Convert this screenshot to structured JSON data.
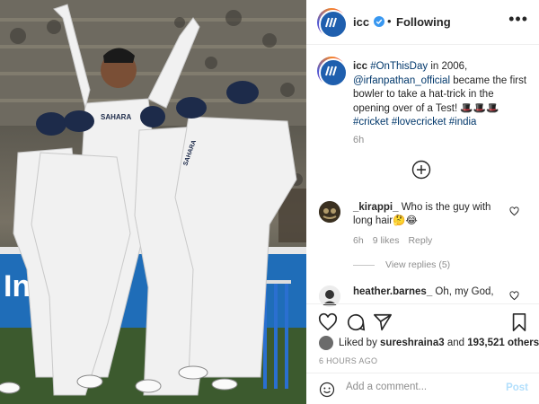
{
  "photo": {
    "description_icon": "cricket-celebration-photo",
    "shirt_text_1": "SAHARA",
    "shirt_text_2": "SAHARA",
    "banner_text": "Ina"
  },
  "header": {
    "username": "icc",
    "separator": "•",
    "follow_status": "Following",
    "more_icon": "more-horizontal-icon",
    "verified_icon": "verified-badge-icon"
  },
  "caption": {
    "username": "icc",
    "segments": [
      {
        "text": "#OnThisDay",
        "link": true
      },
      {
        "text": " in 2006, ",
        "link": false
      },
      {
        "text": "@irfanpathan_official",
        "link": true
      },
      {
        "text": " became the first bowler to take a hat-trick in the opening over of a Test! 🎩🎩🎩 ",
        "link": false
      },
      {
        "text": "#cricket",
        "link": true
      },
      {
        "text": " ",
        "link": false
      },
      {
        "text": "#lovecricket",
        "link": true
      },
      {
        "text": " ",
        "link": false
      },
      {
        "text": "#india",
        "link": true
      }
    ],
    "time": "6h"
  },
  "comments": [
    {
      "username": "_kirappi_",
      "text": "Who is the guy with long hair🤔😂",
      "time": "6h",
      "likes": "9 likes",
      "reply": "Reply"
    },
    {
      "username": "heather.barnes_",
      "text": "Oh, my God,",
      "time": "",
      "likes": "",
      "reply": ""
    }
  ],
  "view_replies": "View replies (5)",
  "actions": {
    "like_icon": "heart-icon",
    "comment_icon": "comment-icon",
    "share_icon": "share-icon",
    "save_icon": "bookmark-icon",
    "load_more_icon": "plus-circle-icon"
  },
  "liked_by": {
    "prefix": "Liked by ",
    "user": "sureshraina3",
    "middle": " and ",
    "count": "193,521 others"
  },
  "posted_ago": "6 HOURS AGO",
  "add_comment": {
    "placeholder": "Add a comment...",
    "post_label": "Post",
    "emoji_icon": "emoji-icon"
  }
}
